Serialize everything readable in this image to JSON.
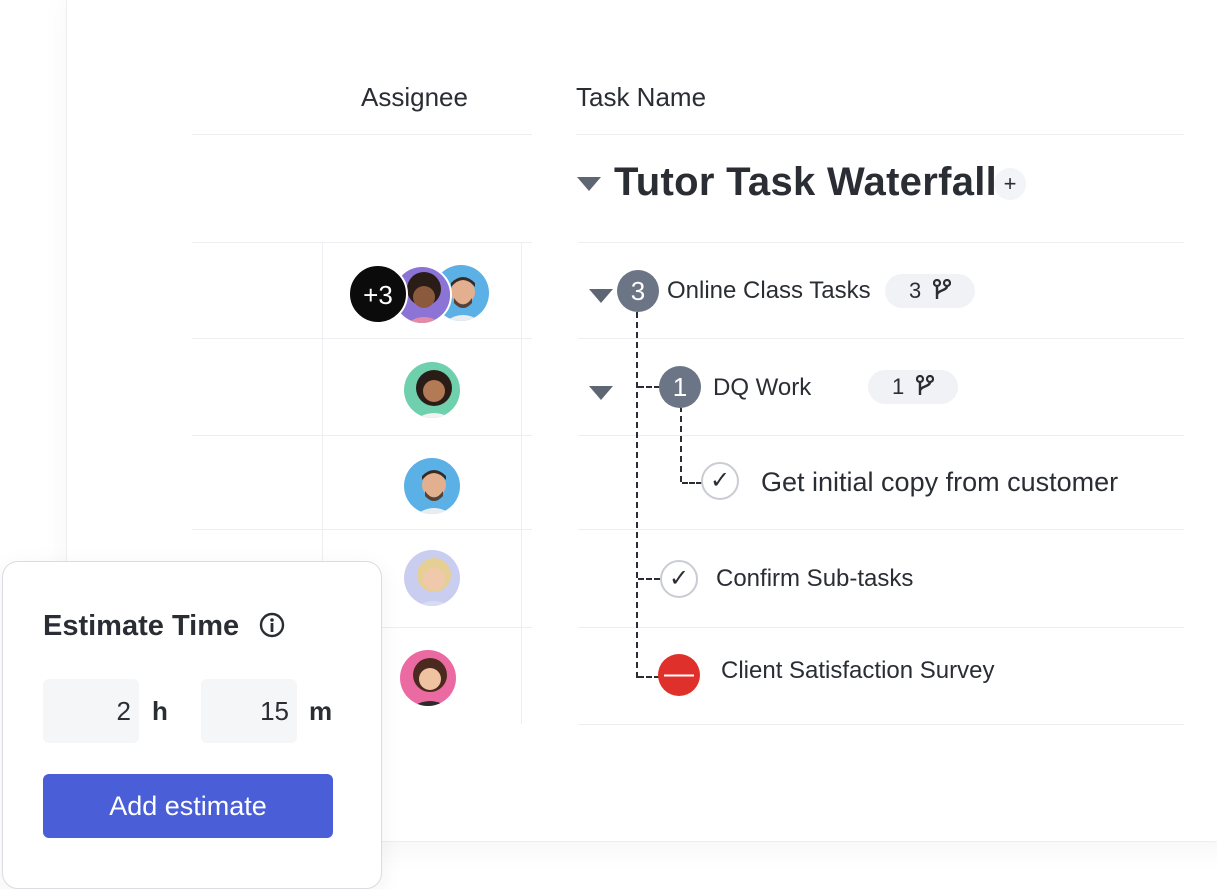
{
  "header": {
    "assignee": "Assignee",
    "task_name": "Task Name"
  },
  "group": {
    "title": "Tutor Task Waterfall",
    "add": "+"
  },
  "tasks": [
    {
      "badge": "3",
      "name": "Online Class Tasks",
      "subtasks": "3"
    },
    {
      "badge": "1",
      "name": "DQ Work",
      "subtasks": "1"
    },
    {
      "check": "✓",
      "name": "Get initial copy from customer"
    },
    {
      "check": "✓",
      "name": "Confirm Sub-tasks"
    },
    {
      "status": "—",
      "name": "Client Satisfaction Survey"
    }
  ],
  "assignees": {
    "more": "+3"
  },
  "estimate": {
    "title": "Estimate Time",
    "hours": "2",
    "hours_unit": "h",
    "minutes": "15",
    "minutes_unit": "m",
    "button": "Add estimate"
  },
  "colors": {
    "accent": "#4a5ed8",
    "badge": "#6b7585",
    "blocked": "#e0302b"
  },
  "icons": [
    "caret-down-icon",
    "plus-icon",
    "subtask-branch-icon",
    "check-icon",
    "blocked-icon",
    "info-icon"
  ]
}
